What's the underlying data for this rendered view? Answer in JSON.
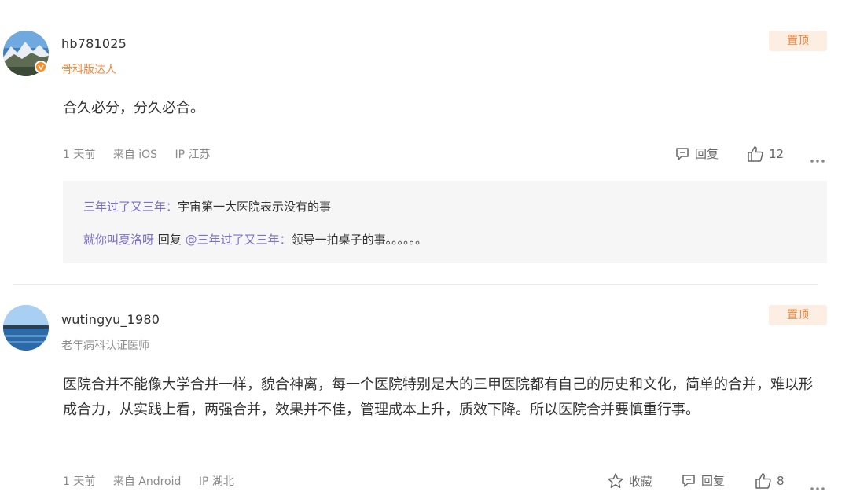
{
  "comments": [
    {
      "username": "hb781025",
      "user_title": "骨科版达人",
      "user_title_color": "#f2853b",
      "pinned_label": "置顶",
      "content": "合久必分，分久必合。",
      "time": "1 天前",
      "source": "来自 iOS",
      "ip": "IP 江苏",
      "reply_label": "回复",
      "like_count": "12",
      "replies": [
        {
          "user": "三年过了又三年",
          "separator": "：",
          "text": "宇宙第一大医院表示没有的事"
        },
        {
          "user": "就你叫夏洛呀",
          "reply_word": " 回复 ",
          "target": "@三年过了又三年",
          "separator": "：",
          "text": "领导一拍桌子的事。。。。。。"
        }
      ]
    },
    {
      "username": "wutingyu_1980",
      "user_title": "老年病科认证医师",
      "user_title_color": "#8a8a8a",
      "pinned_label": "置顶",
      "content": "医院合并不能像大学合并一样，貌合神离，每一个医院特别是大的三甲医院都有自己的历史和文化，简单的合并，难以形成合力，从实践上看，两强合并，效果并不佳，管理成本上升，质效下降。所以医院合并要慎重行事。",
      "time": "1 天前",
      "source": "来自 Android",
      "ip": "IP 湖北",
      "favorite_label": "收藏",
      "reply_label": "回复",
      "like_count": "8"
    }
  ],
  "icons": {
    "verified": "verified-badge-icon",
    "reply": "comment-icon",
    "like": "thumbs-up-icon",
    "favorite": "star-icon",
    "more": "more-dots-icon"
  },
  "colors": {
    "accent_orange": "#f2853b",
    "pin_bg": "#fdeee3",
    "reply_user": "#7b6fcf",
    "reply_bg": "#f6f6f6"
  }
}
